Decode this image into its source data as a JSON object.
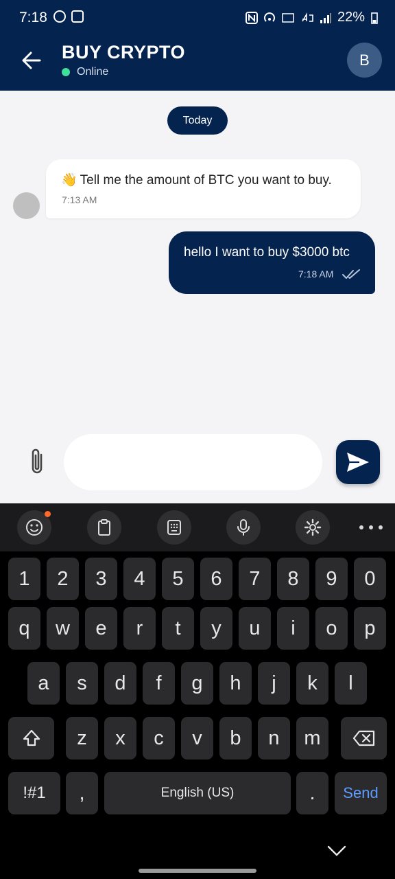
{
  "status_bar": {
    "time": "7:18",
    "battery": "22%"
  },
  "header": {
    "title": "BUY CRYPTO",
    "status": "Online",
    "avatar_initial": "B"
  },
  "chat": {
    "date_pill": "Today",
    "messages": [
      {
        "from": "bot",
        "emoji": "👋",
        "text": "Tell me the amount of BTC you want to buy.",
        "time": "7:13 AM"
      },
      {
        "from": "user",
        "text": "hello I want to buy $3000 btc",
        "time": "7:18 AM",
        "status_icon": "double-check-icon"
      }
    ]
  },
  "composer": {
    "value": "",
    "placeholder": ""
  },
  "keyboard": {
    "row_numbers": [
      "1",
      "2",
      "3",
      "4",
      "5",
      "6",
      "7",
      "8",
      "9",
      "0"
    ],
    "row_q": [
      "q",
      "w",
      "e",
      "r",
      "t",
      "y",
      "u",
      "i",
      "o",
      "p"
    ],
    "row_a": [
      "a",
      "s",
      "d",
      "f",
      "g",
      "h",
      "j",
      "k",
      "l"
    ],
    "row_z": [
      "z",
      "x",
      "c",
      "v",
      "b",
      "n",
      "m"
    ],
    "symbols_label": "!#1",
    "comma": ",",
    "space_label": "English (US)",
    "period": ".",
    "send_label": "Send"
  },
  "colors": {
    "brand": "#05234f",
    "online": "#3fe09a",
    "send_key": "#5f9cff"
  }
}
